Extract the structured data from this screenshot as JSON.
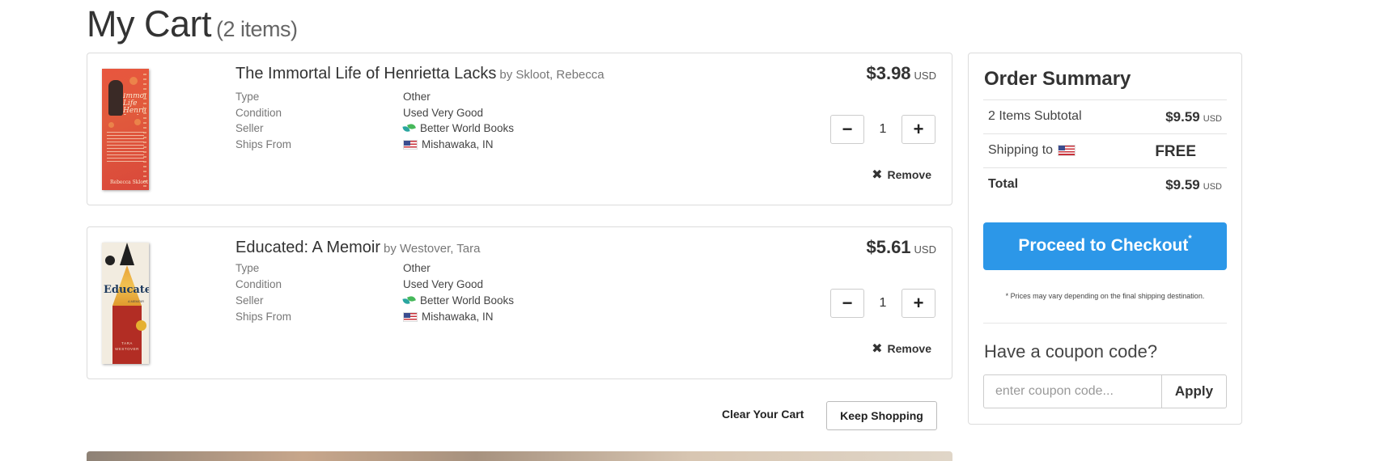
{
  "page": {
    "title": "My Cart",
    "item_count": "(2 items)"
  },
  "labels": {
    "type": "Type",
    "condition": "Condition",
    "seller": "Seller",
    "ships_from": "Ships From",
    "remove": "Remove",
    "currency": "USD"
  },
  "cart_items": [
    {
      "title": "The Immortal Life of Henrietta Lacks",
      "author": "by Skloot, Rebecca",
      "type": "Other",
      "condition": "Used Very Good",
      "seller": "Better World Books",
      "ships_from": "Mishawaka, IN",
      "price": "$3.98",
      "quantity": "1",
      "cover": {
        "title_text": "Immortal Life Henrietta Lacks",
        "author_text": "Rebecca Skloot",
        "colors": [
          "#e15a3c",
          "#3a2a26",
          "#f8e8d0"
        ]
      }
    },
    {
      "title": "Educated: A Memoir",
      "author": "by Westover, Tara",
      "type": "Other",
      "condition": "Used Very Good",
      "seller": "Better World Books",
      "ships_from": "Mishawaka, IN",
      "price": "$5.61",
      "quantity": "1",
      "cover": {
        "title_text": "Educated",
        "subtitle_text": "A MEMOIR",
        "author_text": "TARA WESTOVER",
        "colors": [
          "#f2ece0",
          "#1e3a5e",
          "#b22d24",
          "#e8a33a"
        ]
      }
    }
  ],
  "cart_actions": {
    "clear": "Clear Your Cart",
    "keep_shopping": "Keep Shopping"
  },
  "summary": {
    "title": "Order Summary",
    "subtotal_label": "2 Items Subtotal",
    "subtotal_value": "$9.59",
    "shipping_label": "Shipping to",
    "shipping_value": "FREE",
    "total_label": "Total",
    "total_value": "$9.59",
    "currency": "USD",
    "checkout_label": "Proceed to Checkout",
    "checkout_mark": "*",
    "disclaimer": "* Prices may vary depending on the final shipping destination.",
    "coupon_heading": "Have a coupon code?",
    "coupon_placeholder": "enter coupon code...",
    "apply_label": "Apply"
  },
  "icons": {
    "quantity_minus": "−",
    "quantity_plus": "+",
    "remove": "✖",
    "seller_logo": "better-world-books-icon",
    "flag": "us-flag-icon"
  },
  "colors": {
    "checkout_button": "#2c97e8",
    "border": "#dcdcdc",
    "text": "#333333"
  }
}
